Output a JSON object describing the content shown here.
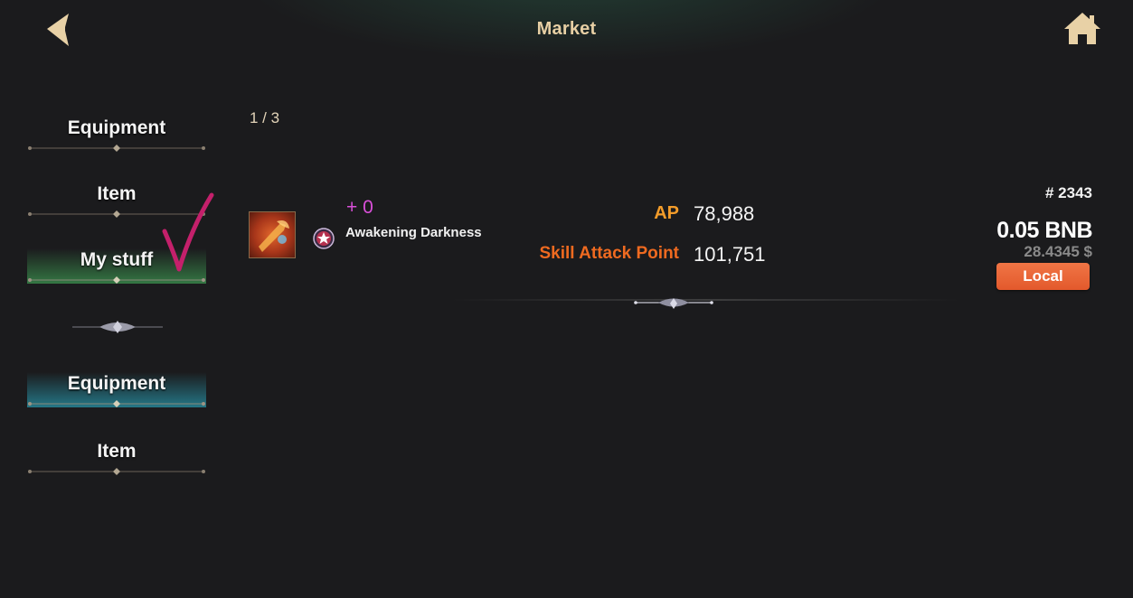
{
  "header": {
    "title": "Market",
    "back_icon": "chevron-left-icon",
    "home_icon": "home-icon"
  },
  "sidebar": {
    "items": [
      {
        "label": "Equipment"
      },
      {
        "label": "Item"
      },
      {
        "label": "My stuff",
        "active": true
      },
      {
        "label": "Equipment",
        "active": true
      },
      {
        "label": "Item"
      }
    ]
  },
  "page_indicator": "1 / 3",
  "listing": {
    "enhance": "+ 0",
    "name": "Awakening Darkness",
    "stats": [
      {
        "label": "AP",
        "value": "78,988"
      },
      {
        "label": "Skill Attack Point",
        "value": "101,751"
      }
    ],
    "id": "# 2343",
    "price": "0.05 BNB",
    "price_usd": "28.4345 $",
    "button_label": "Local"
  },
  "colors": {
    "title": "#e7cfa4",
    "enhance": "#d94fd9",
    "ap": "#f39c2a",
    "sap": "#ef6a20",
    "button": "#e8633a",
    "check_mark": "#c4206b"
  }
}
